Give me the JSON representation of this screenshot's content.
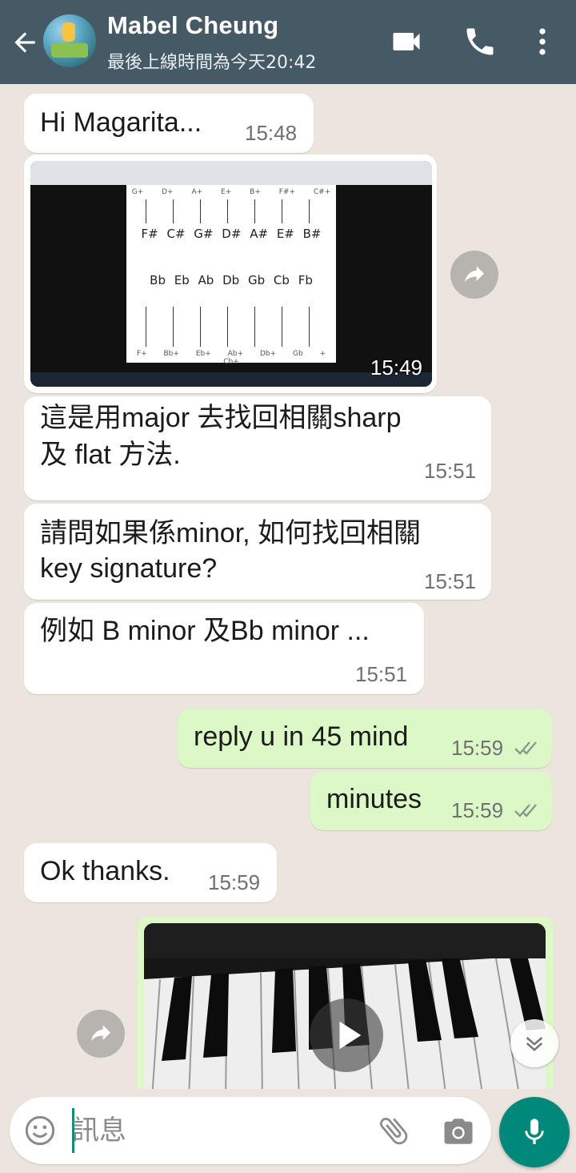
{
  "header": {
    "contact_name": "Mabel Cheung",
    "last_seen": "最後上線時間為今天20:42"
  },
  "messages": [
    {
      "direction": "in",
      "text": "Hi Magarita...",
      "time": "15:48"
    },
    {
      "direction": "in",
      "type": "image",
      "time": "15:49",
      "image_content": {
        "sharp_row_top": [
          "G+",
          "D+",
          "A+",
          "E+",
          "B+",
          "F#+",
          "C#+"
        ],
        "sharp_row": [
          "F#",
          "C#",
          "G#",
          "D#",
          "A#",
          "E#",
          "B#"
        ],
        "flat_row": [
          "Bb",
          "Eb",
          "Ab",
          "Db",
          "Gb",
          "Cb",
          "Fb"
        ],
        "flat_row_bottom": [
          "F+",
          "Bb+",
          "Eb+",
          "Ab+",
          "Db+",
          "Gb +",
          "Cb+"
        ]
      }
    },
    {
      "direction": "in",
      "lines": [
        "這是用major 去找回相關sharp",
        "及 flat 方法."
      ],
      "time": "15:51"
    },
    {
      "direction": "in",
      "lines": [
        "請問如果係minor, 如何找回相關",
        "key signature?"
      ],
      "time": "15:51"
    },
    {
      "direction": "in",
      "text": "例如 B minor 及Bb minor ...",
      "time": "15:51"
    },
    {
      "direction": "out",
      "text": "reply u in 45 mind",
      "time": "15:59",
      "status": "delivered"
    },
    {
      "direction": "out",
      "text": "minutes",
      "time": "15:59",
      "status": "delivered"
    },
    {
      "direction": "in",
      "text": "Ok thanks.",
      "time": "15:59"
    },
    {
      "direction": "out",
      "type": "video"
    }
  ],
  "input": {
    "placeholder": "訊息"
  },
  "colors": {
    "header": "#455a64",
    "outgoing_bubble": "#dcf8c6",
    "incoming_bubble": "#ffffff",
    "chat_bg": "#ece5dd",
    "mic_button": "#00897b"
  },
  "icons": [
    "back-arrow-icon",
    "video-call-icon",
    "phone-icon",
    "more-vert-icon",
    "forward-icon",
    "play-icon",
    "scroll-down-icon",
    "emoji-icon",
    "attach-icon",
    "camera-icon",
    "mic-icon"
  ]
}
